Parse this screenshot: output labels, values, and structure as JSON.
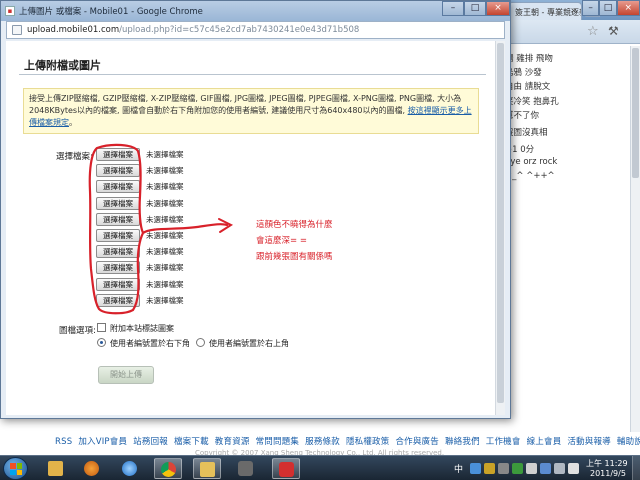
{
  "background_browser": {
    "tab_title": "簽王朝 - 專業競逐新主",
    "sidebar_lines": [
      {
        "text": "楊  雞排  飛吻",
        "link": false
      },
      {
        "text": "烏鴉  沙發",
        "link": false
      },
      {
        "text": "自由  請脫文",
        "link": false
      },
      {
        "text": "笑冷笑  抱鼻孔",
        "link": false
      },
      {
        "text": "幫不了你",
        "link": false
      },
      {
        "text": "沒圖沒真相",
        "link": false
      },
      {
        "text": "+1    0分",
        "link": false
      },
      {
        "text": "bye   orz   rock",
        "link": false
      },
      {
        "text": "^_^    ^++^",
        "link": false
      }
    ],
    "footer_links": [
      "RSS",
      "加入VIP會員",
      "站務回報",
      "檔案下載",
      "教育資源",
      "常問問題集",
      "服務條款",
      "隱私權政策",
      "合作與廣告",
      "聯絡我們",
      "工作機會",
      "線上會員",
      "活動與報導",
      "輔助說明"
    ],
    "copyright": "Copyright © 2007 Xang Sheng Technology Co., Ltd. All rights reserved."
  },
  "popup": {
    "window_title": "上傳圖片 或檔案 - Mobile01 - Google Chrome",
    "url_host": "upload.mobile01.com",
    "url_path": "/upload.php?id=c57c45e2cd7ab7430241e0e43d71b508",
    "page_title": "上傳附檔或圖片",
    "notice_text": "接受上傳ZIP壓縮檔, GZIP壓縮檔, X-ZIP壓縮檔, GIF圖檔, JPG圖檔, JPEG圖檔, PJPEG圖檔, X-PNG圖檔, PNG圖檔, 大小為2048KBytes以內的檔案, 圖檔會自動於右下角附加您的使用者編號, 建議使用尺寸為640x480以內的圖檔, ",
    "notice_link": "按這裡顯示更多上傳檔案規定",
    "notice_tail": "。",
    "file_label": "選擇檔案:",
    "file_rows": [
      {
        "button": "選擇檔案",
        "status": "未選擇檔案"
      },
      {
        "button": "選擇檔案",
        "status": "未選擇檔案"
      },
      {
        "button": "選擇檔案",
        "status": "未選擇檔案"
      },
      {
        "button": "選擇檔案",
        "status": "未選擇檔案"
      },
      {
        "button": "選擇檔案",
        "status": "未選擇檔案"
      },
      {
        "button": "選擇檔案",
        "status": "未選擇檔案"
      },
      {
        "button": "選擇檔案",
        "status": "未選擇檔案"
      },
      {
        "button": "選擇檔案",
        "status": "未選擇檔案"
      },
      {
        "button": "選擇檔案",
        "status": "未選擇檔案"
      },
      {
        "button": "選擇檔案",
        "status": "未選擇檔案"
      }
    ],
    "options_label": "圖檔選項:",
    "watermark_option": "附加本站標誌圖案",
    "position_options": [
      {
        "label": "使用者編號置於右下角",
        "selected": true
      },
      {
        "label": "使用者編號置於右上角",
        "selected": false
      }
    ],
    "upload_button": "開始上傳",
    "annotation_lines": [
      "這顏色不曉得為什麼",
      "會這麼深= =",
      "跟前幾張圖有關係嗎"
    ],
    "annotation_color": "#d8212a"
  },
  "taskbar": {
    "tray_language": "中",
    "clock_time": "上午 11:29",
    "clock_date": "2011/9/5"
  }
}
